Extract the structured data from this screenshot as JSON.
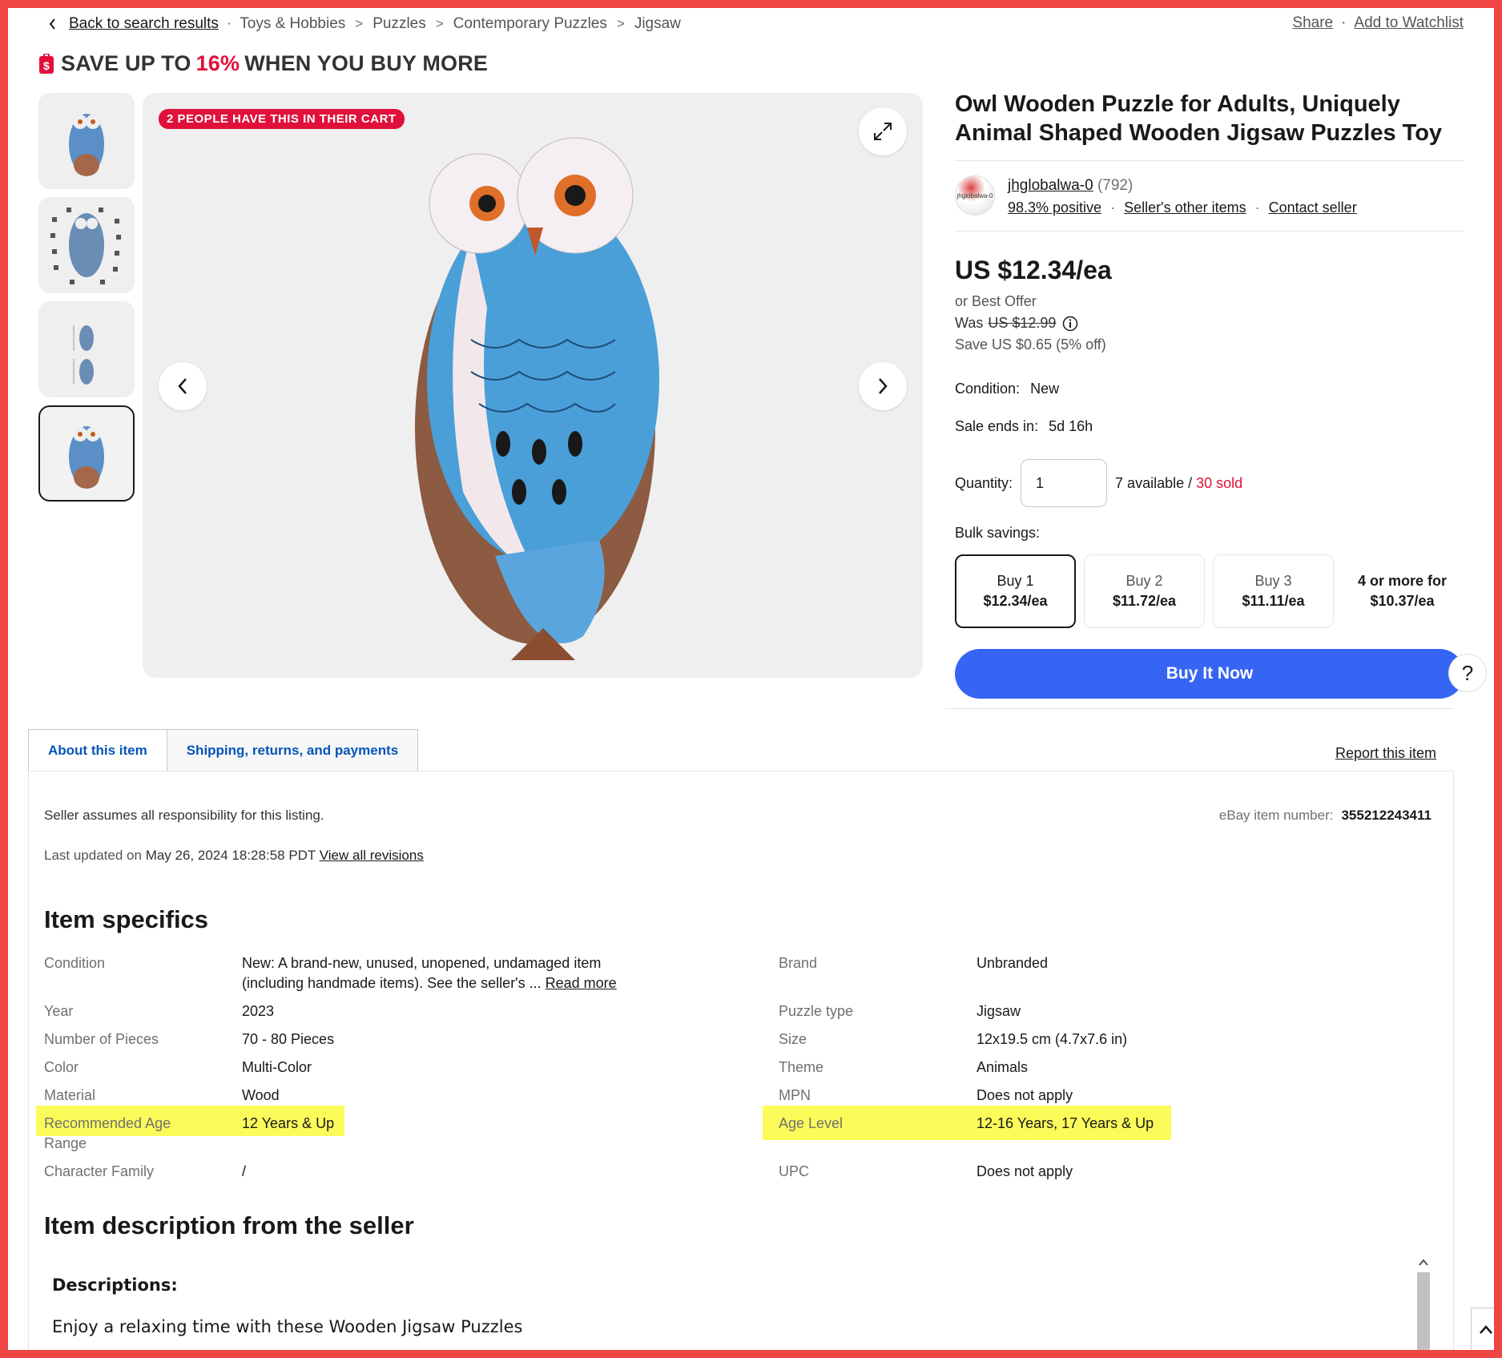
{
  "breadcrumb": {
    "back": "Back to search results",
    "items": [
      "Toys & Hobbies",
      "Puzzles",
      "Contemporary Puzzles",
      "Jigsaw"
    ]
  },
  "top_actions": {
    "share": "Share",
    "watchlist": "Add to Watchlist"
  },
  "promo": {
    "prefix": "SAVE UP TO",
    "percent": "16%",
    "suffix": "WHEN YOU BUY MORE"
  },
  "gallery": {
    "cart_badge": "2 PEOPLE HAVE THIS IN THEIR CART",
    "selected_thumb_index": 3
  },
  "listing": {
    "title": "Owl Wooden Puzzle for Adults, Uniquely Animal Shaped Wooden Jigsaw Puzzles Toy",
    "seller": {
      "avatar_text": "jhglobalwa-0",
      "name": "jhglobalwa-0",
      "feedback_count": "(792)",
      "positive": "98.3% positive",
      "other_items": "Seller's other items",
      "contact": "Contact seller"
    },
    "price": "US $12.34/ea",
    "best_offer": "or Best Offer",
    "was_label": "Was",
    "was_price": "US $12.99",
    "save": "Save US $0.65 (5% off)",
    "condition_label": "Condition:",
    "condition_value": "New",
    "sale_label": "Sale ends in:",
    "sale_value": "5d 16h",
    "quantity_label": "Quantity:",
    "quantity_value": "1",
    "available": "7 available /",
    "sold": "30 sold",
    "bulk_label": "Bulk savings:",
    "bulk": [
      {
        "qty": "Buy 1",
        "price": "$12.34/ea"
      },
      {
        "qty": "Buy 2",
        "price": "$11.72/ea"
      },
      {
        "qty": "Buy 3",
        "price": "$11.11/ea"
      },
      {
        "qty": "4 or more for",
        "price": "$10.37/ea"
      }
    ],
    "buy_now": "Buy It Now",
    "help": "?"
  },
  "tabs": {
    "items": [
      "About this item",
      "Shipping, returns, and payments"
    ],
    "active": 0,
    "report": "Report this item"
  },
  "about": {
    "responsibility": "Seller assumes all responsibility for this listing.",
    "updated_prefix": "Last updated on",
    "updated_ts": "May 26, 2024 18:28:58 PDT",
    "revisions": "View all revisions",
    "item_number_label": "eBay item number:",
    "item_number": "355212243411"
  },
  "specifics": {
    "heading": "Item specifics",
    "left": [
      {
        "label": "Condition",
        "value": "New: A brand-new, unused, unopened, undamaged item (including handmade items). See the seller's ...",
        "link": "Read more"
      },
      {
        "label": "Year",
        "value": "2023"
      },
      {
        "label": "Number of Pieces",
        "value": "70 - 80 Pieces"
      },
      {
        "label": "Color",
        "value": "Multi-Color"
      },
      {
        "label": "Material",
        "value": "Wood"
      },
      {
        "label": "Recommended Age Range",
        "value": "12 Years & Up",
        "highlight": true
      },
      {
        "label": "Character Family",
        "value": "/"
      }
    ],
    "right": [
      {
        "label": "Brand",
        "value": "Unbranded"
      },
      {
        "label": "Puzzle type",
        "value": "Jigsaw"
      },
      {
        "label": "Size",
        "value": "12x19.5 cm (4.7x7.6 in)"
      },
      {
        "label": "Theme",
        "value": "Animals"
      },
      {
        "label": "MPN",
        "value": "Does not apply"
      },
      {
        "label": "Age Level",
        "value": "12-16 Years, 17 Years & Up",
        "highlight": true
      },
      {
        "label": "UPC",
        "value": "Does not apply"
      }
    ]
  },
  "description": {
    "heading": "Item description from the seller",
    "line1": "Descriptions:",
    "line2": "Enjoy a relaxing time with these Wooden Jigsaw Puzzles"
  },
  "colors": {
    "accent": "#3665f3",
    "alert": "#e0103a",
    "highlight": "#fbfb5a",
    "frame": "#f04545",
    "link_blue": "#0654ba"
  }
}
